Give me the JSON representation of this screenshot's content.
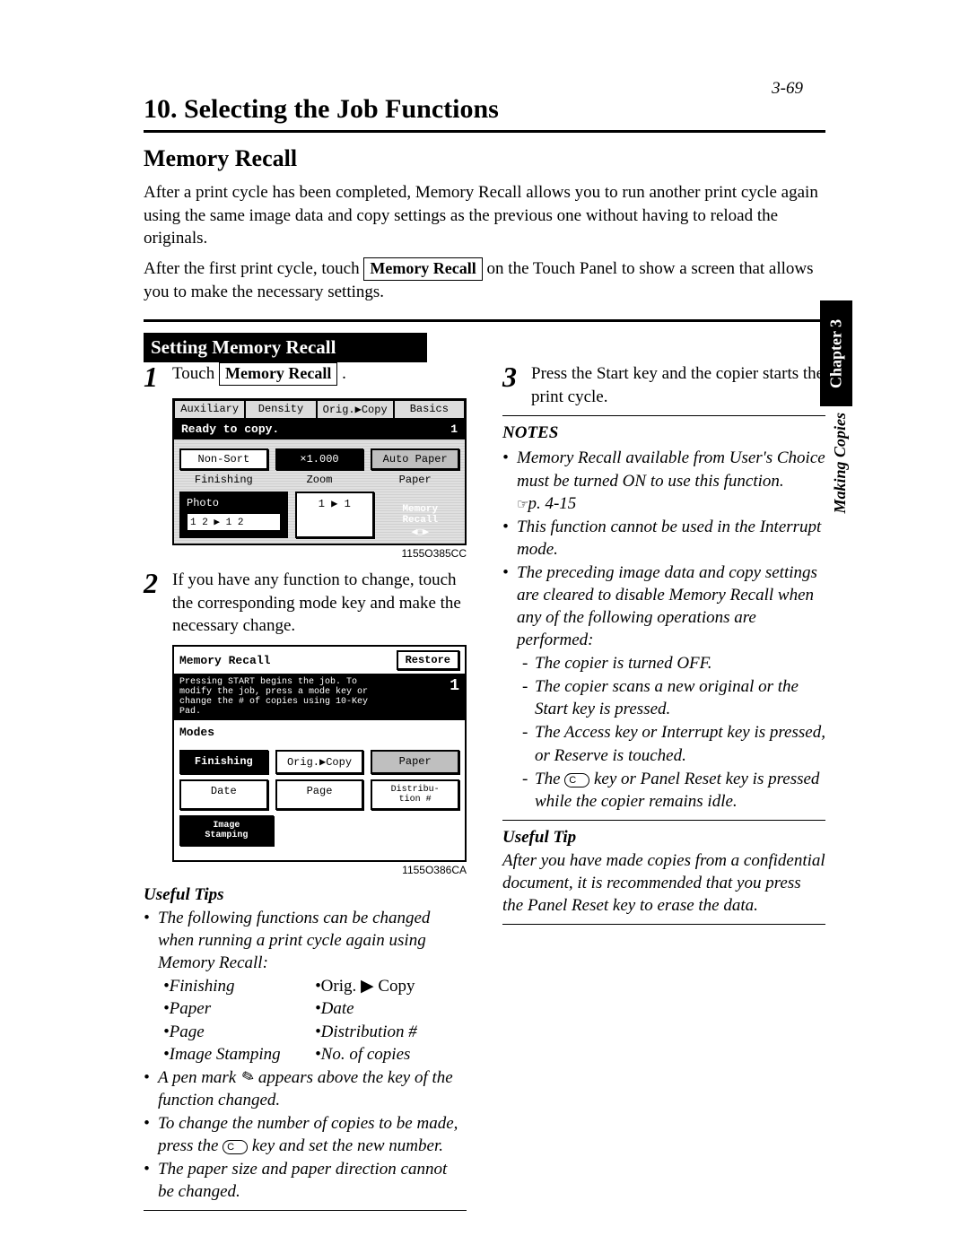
{
  "pageNumber": "3-69",
  "sideTab": "Chapter 3",
  "sideText": "Making Copies",
  "title": "10. Selecting the Job Functions",
  "subTitle": "Memory Recall",
  "intro1": "After a print cycle has been completed, Memory Recall allows you to run another print cycle again using the same image data and copy settings as the previous one without having to reload the originals.",
  "intro2a": "After the first print cycle, touch ",
  "introBtn": "Memory Recall",
  "intro2b": " on the Touch Panel to show a screen that allows you to make the necessary settings.",
  "blackBar": "Setting Memory Recall",
  "step1a": "Touch ",
  "step1btn": "Memory Recall",
  "step1b": " .",
  "screen1": {
    "tabs": [
      "Auxiliary",
      "Density",
      "Orig.▶Copy",
      "Basics"
    ],
    "status": "Ready to copy.",
    "count": "1",
    "row1": [
      "Non-Sort",
      "×1.000",
      "Auto Paper"
    ],
    "labels1": [
      "Finishing",
      "Zoom",
      "Paper"
    ],
    "photo": "Photo",
    "iconStrip": "1 2 ▶ 1 2",
    "ratio": "1 ▶ 1",
    "memory": "Memory\nRecall",
    "id": "1155O385CC"
  },
  "step2": "If you have any function to change, touch the corresponding mode key and make the necessary change.",
  "screen2": {
    "title": "Memory Recall",
    "restore": "Restore",
    "info": "Pressing START begins the job. To modify the job, press a mode key or change the # of copies using 10-Key Pad.",
    "count": "1",
    "modes": "Modes",
    "row1": [
      "Finishing",
      "Orig.▶Copy",
      "Paper"
    ],
    "row2": [
      "Date",
      "Page",
      "Distribu-\ntion #"
    ],
    "row3": "Image\nStamping",
    "id": "1155O386CA"
  },
  "usefulTipsL": {
    "head": "Useful Tips",
    "b1": "The following functions can be changed when running a print cycle again using Memory Recall:",
    "listL": [
      "Finishing",
      "Paper",
      "Page",
      "Image Stamping"
    ],
    "listR": [
      "Orig. ▶ Copy",
      "Date",
      "Distribution #",
      "No. of copies"
    ],
    "b2a": "A pen mark ",
    "b2b": " appears above the key of the function changed.",
    "b3a": "To change the number of copies to be made, press the ",
    "b3b": " key and set the new number.",
    "b4": "The paper size and paper direction cannot be changed."
  },
  "step3": "Press the Start key and the copier starts the print cycle.",
  "notes": {
    "head": "NOTES",
    "b1a": "Memory Recall available from User's Choice must be turned ON to use this function.",
    "b1ref": "p. 4-15",
    "b2": "This function cannot be used in the Interrupt mode.",
    "b3": "The preceding image data and copy settings are cleared to disable Memory Recall when any of the following operations are performed:",
    "s1": "The copier is turned OFF.",
    "s2": "The copier scans a new original or the Start key is pressed.",
    "s3": "The Access key or Interrupt key is pressed, or Reserve is touched.",
    "s4a": "The ",
    "s4b": " key or Panel Reset key is pressed while the copier remains idle."
  },
  "usefulTipR": {
    "head": "Useful Tip",
    "text": "After you have made copies from a confidential document, it is recommended that you press the Panel Reset key to erase the data."
  },
  "cKey": "C"
}
